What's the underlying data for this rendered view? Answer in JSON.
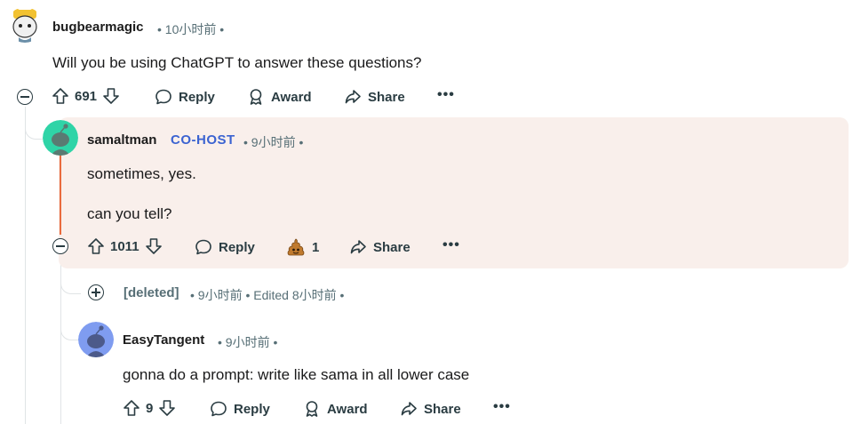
{
  "comment1": {
    "username": "bugbearmagic",
    "time": "• 10小时前 •",
    "body": "Will you be using ChatGPT to answer these questions?",
    "votes": "691",
    "reply": "Reply",
    "award": "Award",
    "share": "Share",
    "more": "•••"
  },
  "comment2": {
    "username": "samaltman",
    "flair": "CO-HOST",
    "time": "• 9小时前 •",
    "body_line1": "sometimes, yes.",
    "body_line2": "can you tell?",
    "votes": "1011",
    "reply": "Reply",
    "award_count": "1",
    "share": "Share",
    "more": "•••",
    "highlight_color": "#f9efeb",
    "accent_color": "#e96b3e"
  },
  "comment3": {
    "username": "[deleted]",
    "time": "• 9小时前 • Edited 8小时前 •"
  },
  "comment4": {
    "username": "EasyTangent",
    "time": "• 9小时前 •",
    "body": "gonna do a prompt: write like sama in all lower case",
    "votes": "9",
    "reply": "Reply",
    "award": "Award",
    "share": "Share",
    "more": "•••"
  },
  "icons": {
    "upvote": "upvote-arrow-icon",
    "downvote": "downvote-arrow-icon",
    "reply": "speech-bubble-icon",
    "award": "award-ribbon-icon",
    "share": "share-arrow-icon",
    "more": "ellipsis-icon"
  }
}
